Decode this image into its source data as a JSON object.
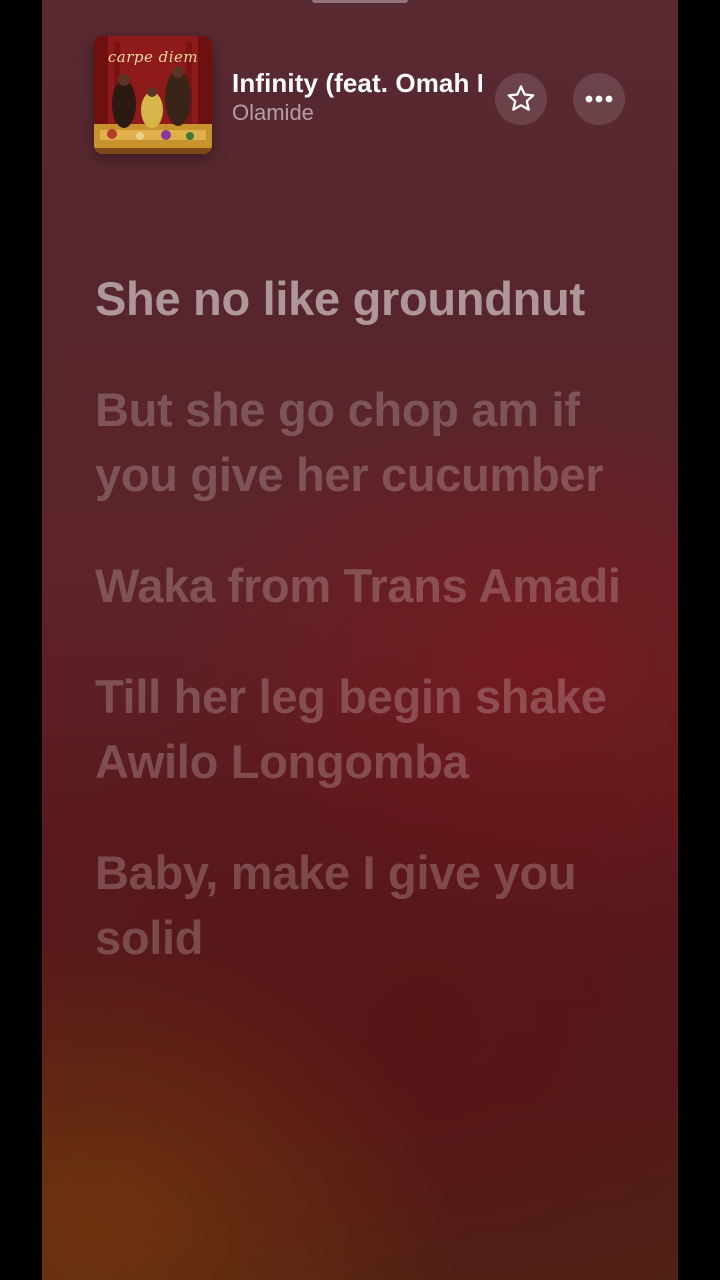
{
  "now_playing": {
    "album_art_text": "carpe diem",
    "title": "Infinity (feat. Omah Lay)",
    "artist": "Olamide"
  },
  "icons": {
    "favorite": "star-outline-icon",
    "more": "ellipsis-icon"
  },
  "lyrics": [
    {
      "text": "She no like groundnut",
      "state": "active"
    },
    {
      "text": "But she go chop am if you give her cucumber",
      "state": "upcoming"
    },
    {
      "text": "Waka from Trans Amadi",
      "state": "upcoming"
    },
    {
      "text": "Till her leg begin shake Awilo Longomba",
      "state": "upcoming"
    },
    {
      "text": "Baby, make I give you solid",
      "state": "upcoming"
    }
  ]
}
